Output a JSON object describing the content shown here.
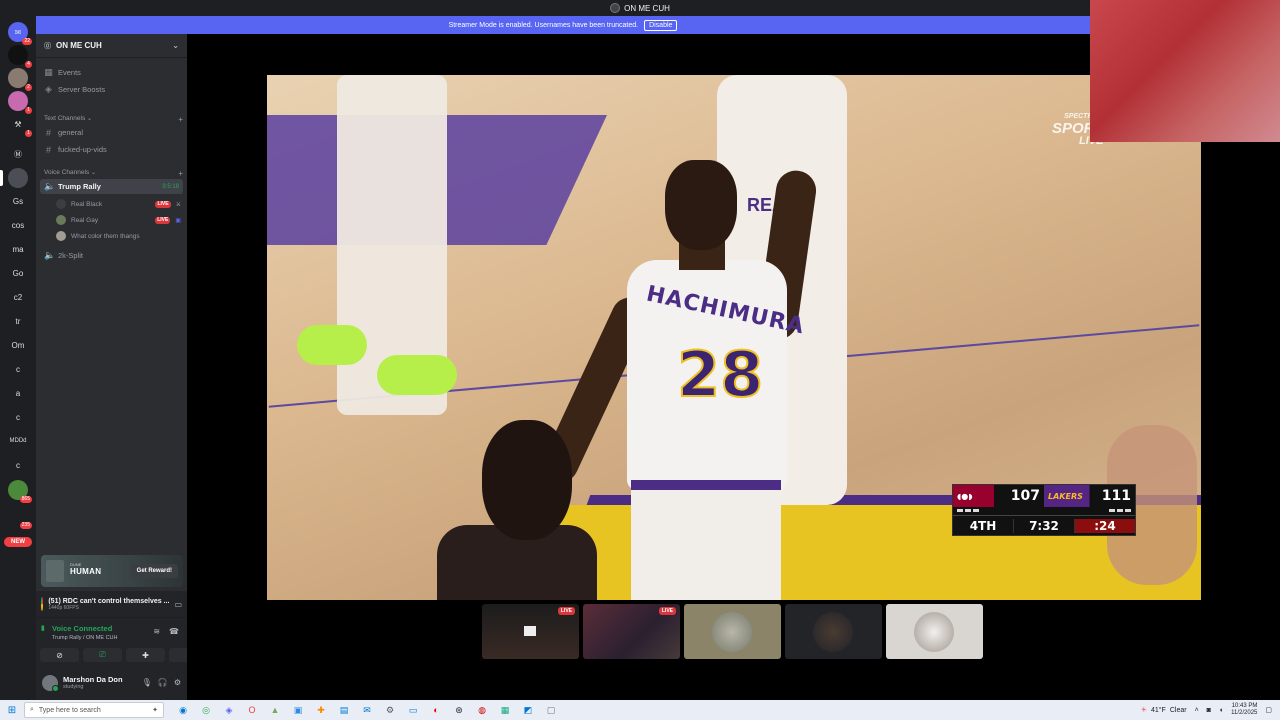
{
  "window": {
    "title": "ON ME CUH"
  },
  "banner": {
    "message": "Streamer Mode is enabled. Usernames have been truncated.",
    "disable_label": "Disable"
  },
  "rail": {
    "badges": {
      "dm": "22",
      "s1": "4",
      "s2": "2",
      "s3": "1",
      "s4": "1",
      "s5": "865",
      "s6": "235"
    },
    "text_items": [
      "Gs",
      "cos",
      "ma",
      "Go",
      "c2",
      "tr",
      "Om",
      "c",
      "a",
      "c",
      "MDDd",
      "c",
      "c"
    ],
    "new_label": "NEW"
  },
  "sidebar": {
    "guild_name": "ON ME CUH",
    "events": "Events",
    "boosts": "Server Boosts",
    "text_category": "Text Channels",
    "text_channels": [
      "general",
      "fucked-up-vids"
    ],
    "voice_category": "Voice Channels",
    "voice_active": {
      "name": "Trump Rally",
      "timer": "9:5:18"
    },
    "voice_users": [
      {
        "name": "Real Black",
        "live": "LIVE"
      },
      {
        "name": "Real Gay",
        "live": "LIVE"
      },
      {
        "name": "What color them thangs",
        "live": ""
      }
    ],
    "voice_other": "2k-Split"
  },
  "promo": {
    "title": "HUMAN",
    "sub": "DUNE",
    "cta": "Get Reward!"
  },
  "activity": {
    "title": "(51) RDC can't control themselves ...",
    "sub": "1440p 60FPS"
  },
  "voice": {
    "status": "Voice Connected",
    "location": "Trump Rally / ON ME CUH"
  },
  "user": {
    "name": "Marshon Da Don",
    "status": "studying"
  },
  "stream": {
    "network_top": "SPECTRUM",
    "network_main": "SPORT",
    "network_live": "LIVE",
    "player_name": "HACHIMURA",
    "player_number": "28",
    "bg_name": "REAV"
  },
  "scorebug": {
    "away_score": "107",
    "home_logo": "LAKERS",
    "home_score": "111",
    "quarter": "4TH",
    "clock": "7:32",
    "shot_clock": ":24"
  },
  "thumbs": {
    "live1": "LIVE",
    "live2": "LIVE"
  },
  "taskbar": {
    "search_placeholder": "Type here to search",
    "temp": "41°F",
    "weather": "Clear",
    "time": "10:43 PM",
    "date": "11/2/2025"
  }
}
